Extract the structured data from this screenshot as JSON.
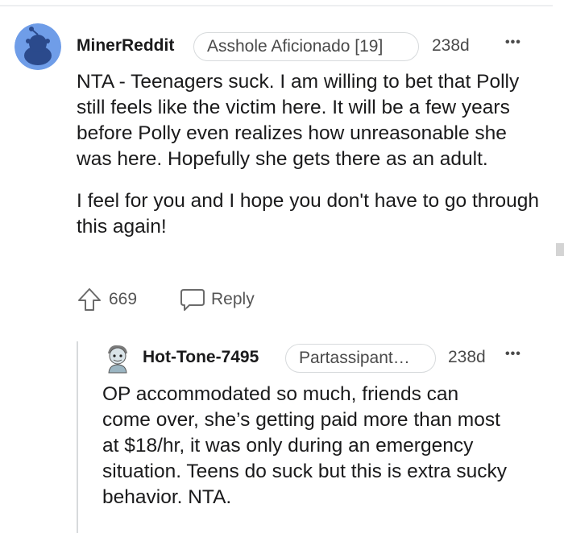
{
  "comment": {
    "username": "MinerReddit",
    "flair": "Asshole Aficionado [19]",
    "age": "238d",
    "more_label": "•••",
    "paragraphs": [
      "NTA - Teenagers suck. I am willing to bet that Polly still feels like the victim here. It will be a few years before Polly even realizes how unreasonable she was here. Hopefully she gets there as an adult.",
      "I feel for you and I hope you don't have to go through this again!"
    ],
    "upvotes": "669",
    "reply_label": "Reply"
  },
  "reply": {
    "username": "Hot-Tone-7495",
    "flair": "Partassipant…",
    "age": "238d",
    "more_label": "•••",
    "body": "OP accommodated so much, friends can come over, she’s getting paid more than most at $18/hr, it was only during an emergency situation. Teens do suck but this is extra sucky behavior. NTA."
  },
  "colors": {
    "avatar_bg": "#6f9de8",
    "avatar_figure": "#2b4a8c",
    "text": "#1a1a1b",
    "meta": "#4a4a4a",
    "border": "#d7dadc"
  },
  "icons": [
    "default-avatar-icon",
    "upvote-arrow-icon",
    "reply-bubble-icon",
    "cartoon-avatar-icon",
    "more-options-icon"
  ]
}
